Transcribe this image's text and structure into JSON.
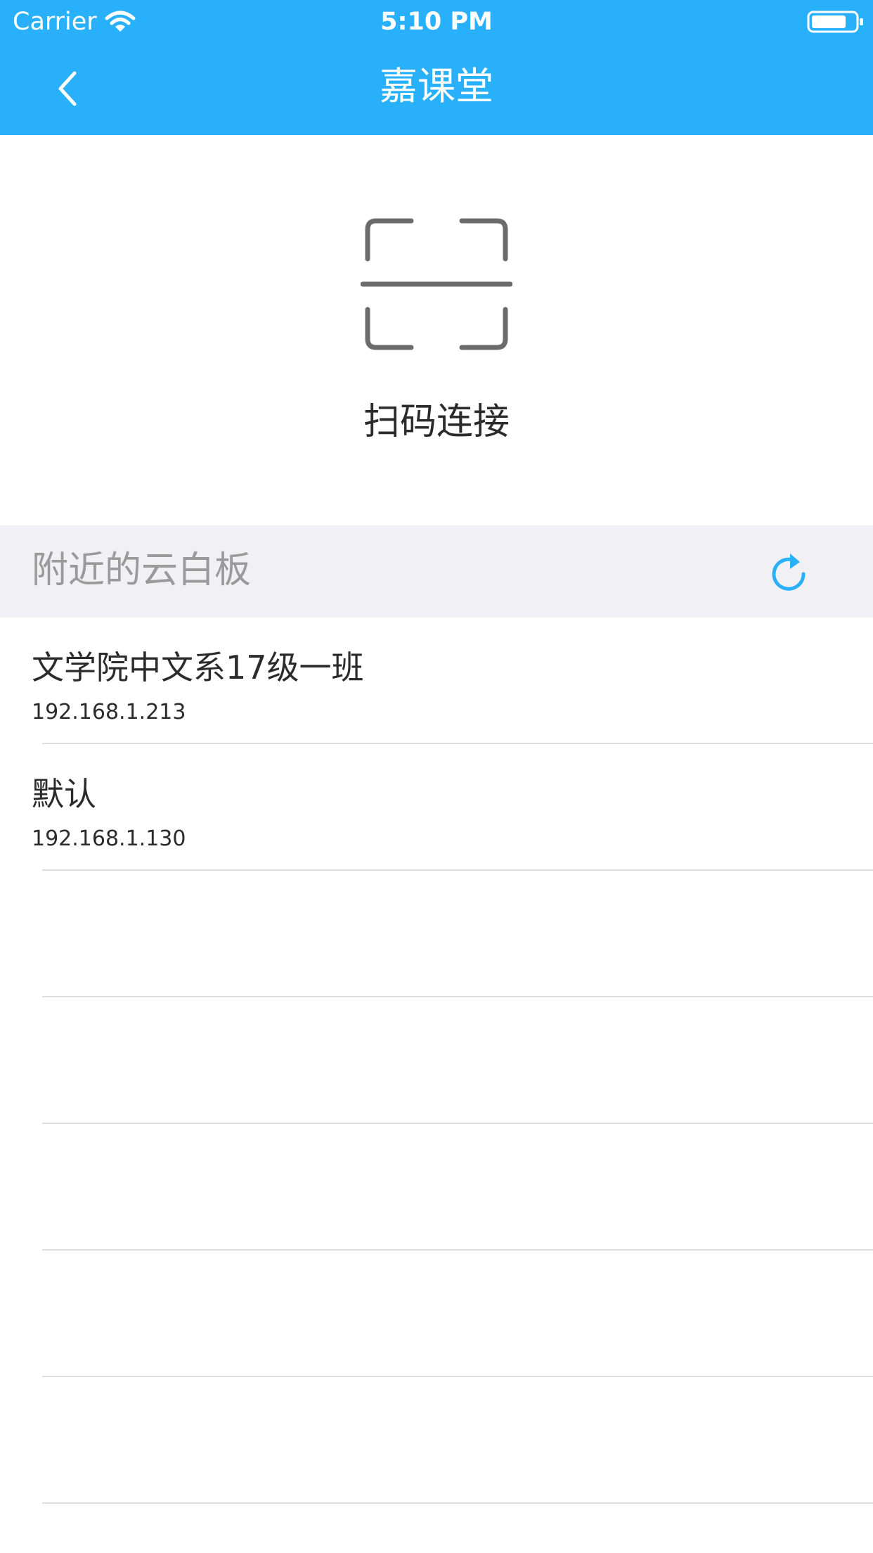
{
  "status_bar": {
    "carrier": "Carrier",
    "time": "5:10 PM",
    "wifi_icon": "wifi-icon",
    "battery_icon": "battery-icon"
  },
  "nav": {
    "title": "嘉课堂",
    "back_icon": "chevron-left-icon"
  },
  "scan": {
    "label": "扫码连接",
    "icon": "qr-scan-icon"
  },
  "section": {
    "title": "附近的云白板",
    "refresh_icon": "refresh-icon"
  },
  "devices": [
    {
      "name": "文学院中文系17级一班",
      "ip": "192.168.1.213"
    },
    {
      "name": "默认",
      "ip": "192.168.1.130"
    }
  ],
  "colors": {
    "accent": "#29b0fb",
    "section_bg": "#f0f0f5",
    "text": "#2b2b2b",
    "muted": "#9a9a9a"
  }
}
